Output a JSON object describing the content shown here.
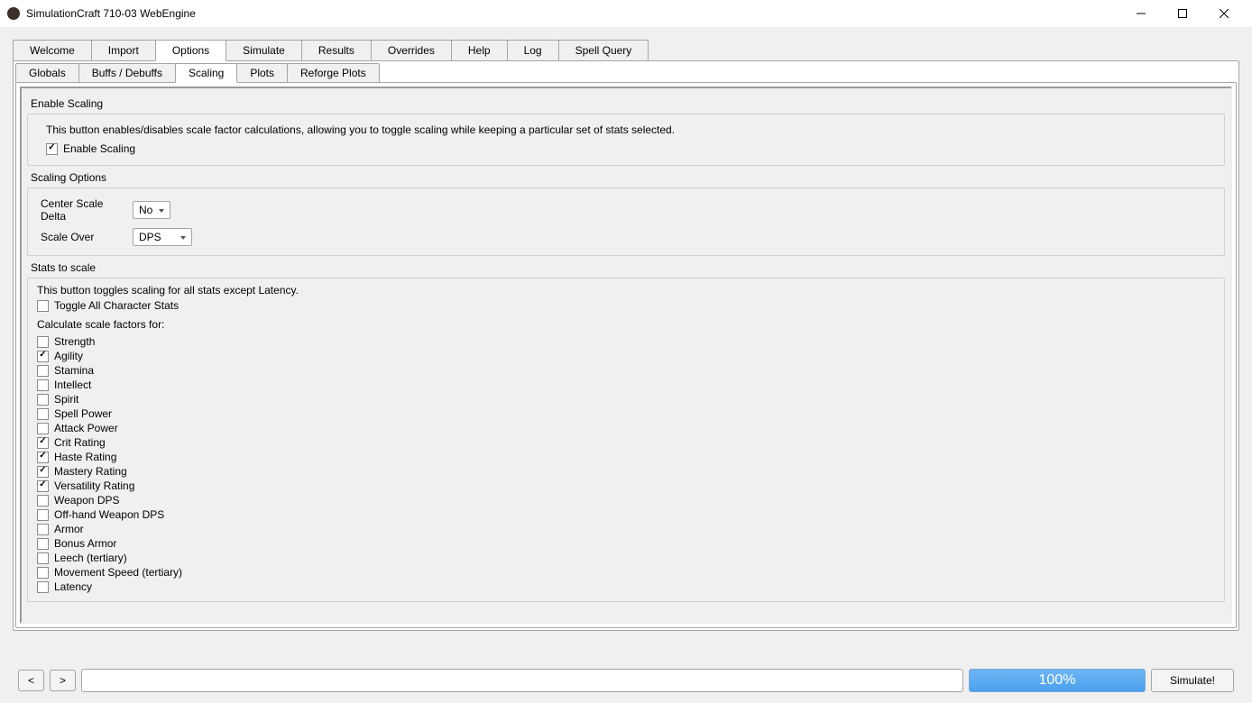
{
  "window": {
    "title": "SimulationCraft 710-03 WebEngine"
  },
  "primary_tabs": [
    "Welcome",
    "Import",
    "Options",
    "Simulate",
    "Results",
    "Overrides",
    "Help",
    "Log",
    "Spell Query"
  ],
  "primary_active": "Options",
  "secondary_tabs": [
    "Globals",
    "Buffs / Debuffs",
    "Scaling",
    "Plots",
    "Reforge Plots"
  ],
  "secondary_active": "Scaling",
  "enable_scaling_group": {
    "title": "Enable Scaling",
    "desc": "This button enables/disables scale factor calculations, allowing you to toggle scaling while keeping a particular set of stats selected.",
    "checkbox_label": "Enable Scaling",
    "checked": true
  },
  "scaling_options": {
    "title": "Scaling Options",
    "center_delta_label": "Center Scale Delta",
    "center_delta_value": "No",
    "scale_over_label": "Scale Over",
    "scale_over_value": "DPS"
  },
  "stats_to_scale": {
    "title": "Stats to scale",
    "toggle_desc": "This button toggles scaling for all stats except Latency.",
    "toggle_label": "Toggle All Character Stats",
    "toggle_checked": false,
    "calc_title": "Calculate scale factors for:",
    "stats": [
      {
        "label": "Strength",
        "checked": false
      },
      {
        "label": "Agility",
        "checked": true
      },
      {
        "label": "Stamina",
        "checked": false
      },
      {
        "label": "Intellect",
        "checked": false
      },
      {
        "label": "Spirit",
        "checked": false
      },
      {
        "label": "Spell Power",
        "checked": false
      },
      {
        "label": "Attack Power",
        "checked": false
      },
      {
        "label": "Crit Rating",
        "checked": true
      },
      {
        "label": "Haste Rating",
        "checked": true
      },
      {
        "label": "Mastery Rating",
        "checked": true
      },
      {
        "label": "Versatility Rating",
        "checked": true
      },
      {
        "label": "Weapon DPS",
        "checked": false
      },
      {
        "label": "Off-hand Weapon DPS",
        "checked": false
      },
      {
        "label": "Armor",
        "checked": false
      },
      {
        "label": "Bonus Armor",
        "checked": false
      },
      {
        "label": "Leech (tertiary)",
        "checked": false
      },
      {
        "label": "Movement Speed (tertiary)",
        "checked": false
      },
      {
        "label": "Latency",
        "checked": false
      }
    ]
  },
  "footer": {
    "back": "<",
    "forward": ">",
    "progress": "100%",
    "simulate": "Simulate!"
  }
}
